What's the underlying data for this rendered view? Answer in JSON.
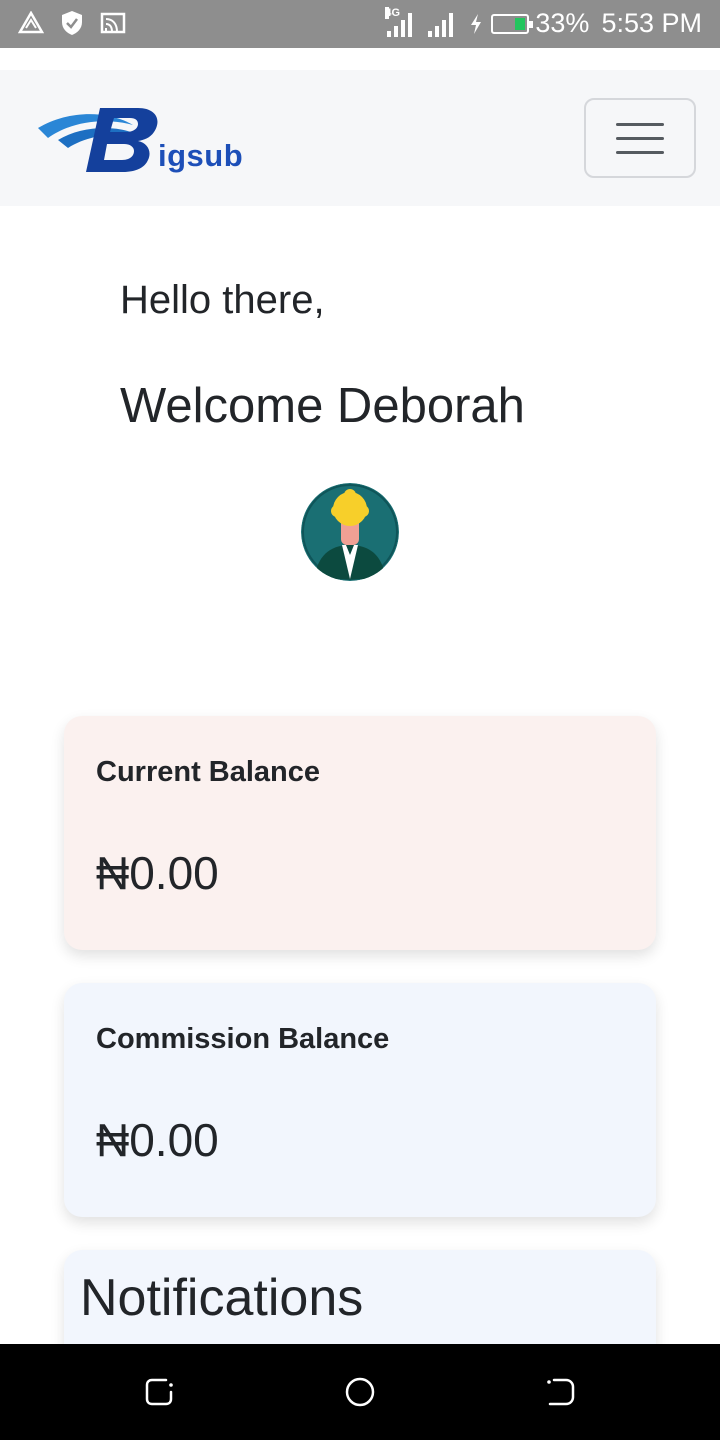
{
  "status_bar": {
    "network_type": "4G",
    "battery_percent": "33%",
    "time": "5:53 PM",
    "battery_level": 0.33,
    "battery_color": "#22c55e",
    "left_icons": [
      "nav-triangle-icon",
      "shield-icon",
      "cast-icon"
    ]
  },
  "navbar": {
    "logo_text": "igsub",
    "logo_letter": "B",
    "brand_color": "#1d4fb8",
    "menu_icon": "hamburger-icon"
  },
  "main": {
    "greeting": "Hello there,",
    "welcome": "Welcome Deborah",
    "avatar_icon": "user-avatar"
  },
  "cards": {
    "current_balance": {
      "label": "Current Balance",
      "amount": "₦0.00"
    },
    "commission_balance": {
      "label": "Commission Balance",
      "amount": "₦0.00"
    },
    "notifications": {
      "title": "Notifications"
    }
  },
  "system_nav": {
    "buttons": [
      "recents-button",
      "home-button",
      "back-button"
    ]
  }
}
